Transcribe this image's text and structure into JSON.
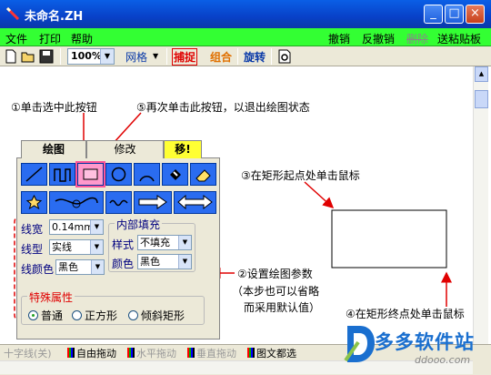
{
  "window": {
    "title": "未命名.ZH",
    "minimize": "_",
    "maximize": "□",
    "close": "×"
  },
  "menu": {
    "file": "文件",
    "print": "打印",
    "help": "帮助",
    "undo": "撤销",
    "redo": "反撤销",
    "clipboard_disabled": "删除",
    "paste_post": "送粘贴板"
  },
  "toolbar": {
    "zoom": "100%",
    "grid": "网格",
    "snap": "捕捉",
    "group": "组合",
    "rotate": "旋转",
    "icons": [
      "new-icon",
      "open-icon",
      "save-icon",
      "preview-icon"
    ]
  },
  "annotations": {
    "step1": "①单击选中此按钮",
    "step5": "⑤再次单击此按钮，以退出绘图状态",
    "step3": "③在矩形起点处单击鼠标",
    "step2_line1": "②设置绘图参数",
    "step2_line2": "（本步也可以省略",
    "step2_line3": "而采用默认值）",
    "step4": "④在矩形终点处单击鼠标"
  },
  "panel": {
    "tabs": {
      "draw": "绘图",
      "modify": "修改",
      "move": "移!"
    },
    "tools_row1": [
      "line-tool-icon",
      "polyline-tool-icon",
      "rectangle-tool-icon",
      "circle-tool-icon",
      "arc-tool-icon",
      "fill-tool-icon",
      "eraser-tool-icon"
    ],
    "tools_row2": [
      "star-tool-icon",
      "curve-tool-icon",
      "wave-tool-icon",
      "arrow-right-tool-icon",
      "arrow-double-tool-icon"
    ],
    "line_width_label": "线宽",
    "line_width_value": "0.14mm",
    "line_type_label": "线型",
    "line_type_value": "实线",
    "line_color_label": "线颜色",
    "line_color_value": "黑色",
    "fill_group": "内部填充",
    "style_label": "样式",
    "style_value": "不填充",
    "color_label": "颜色",
    "color_value": "黑色",
    "special_group": "特殊属性",
    "radio_normal": "普通",
    "radio_square": "正方形",
    "radio_tilted": "倾斜矩形"
  },
  "statusbar": {
    "cross": "十字线(关)",
    "free_drag": "自由拖动",
    "horiz_drag": "水平拖动",
    "vert_drag": "垂直拖动",
    "text_select": "图文都选"
  },
  "watermark": {
    "name": "多多软件站",
    "url": "ddooo.com"
  },
  "colors": {
    "accent_red": "#e00000",
    "menubar": "#33ff33",
    "tool_blue": "#2a6cf0",
    "annotation_blue": "#1a6fcf"
  }
}
